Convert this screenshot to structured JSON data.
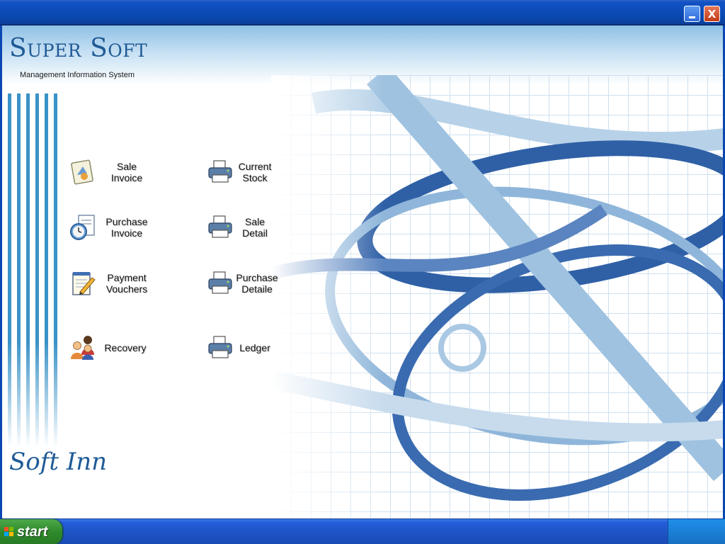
{
  "window": {
    "minimize_label": "_",
    "close_label": "X"
  },
  "app": {
    "title": "Super Soft",
    "subtitle": "Management Information System",
    "vendor": "Soft Inn"
  },
  "menu": {
    "sale_invoice": "Sale\nInvoice",
    "purchase_invoice": "Purchase\nInvoice",
    "payment_vouchers": "Payment\nVouchers",
    "recovery": "Recovery",
    "current_stock": "Current\nStock",
    "sale_detail": "Sale\nDetail",
    "purchase_detaile": "Purchase\nDetaile",
    "ledger": "Ledger"
  },
  "icons": {
    "sale_invoice": "invoice-document-icon",
    "purchase_invoice": "clock-document-icon",
    "payment_vouchers": "notepad-pencil-icon",
    "recovery": "people-icon",
    "current_stock": "printer-icon",
    "sale_detail": "printer-icon",
    "purchase_detaile": "printer-icon",
    "ledger": "printer-icon"
  },
  "taskbar": {
    "start_label": "start"
  },
  "colors": {
    "titlebar": "#0a4ab4",
    "brand": "#1f5a96",
    "stripe": "#3a92c7",
    "start": "#2f8a2c"
  }
}
